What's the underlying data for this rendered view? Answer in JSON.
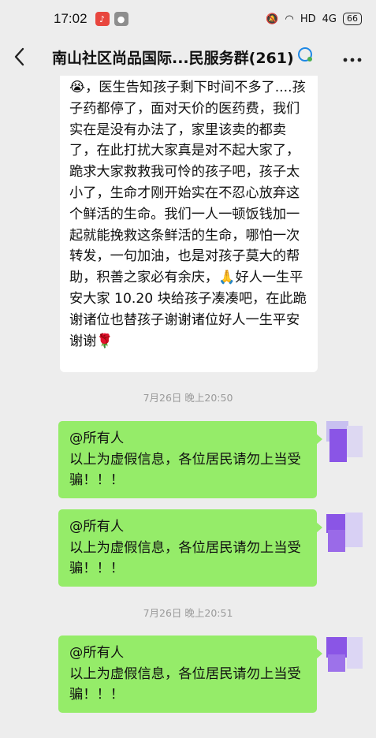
{
  "status_bar": {
    "time": "17:02",
    "network": "HD",
    "signal": "4G",
    "battery": "66"
  },
  "header": {
    "back_icon": "back-chevron-icon",
    "title": "南山社区尚品国际...民服务群(261)",
    "title_icon": "chat-search-icon",
    "more_icon": "more-dots-icon"
  },
  "messages": {
    "long_text": "😭，医生告知孩子剩下时间不多了....孩子药都停了，面对天价的医药费，我们实在是没有办法了，家里该卖的都卖了，在此打扰大家真是对不起大家了，跪求大家救救我可怜的孩子吧，孩子太小了，生命才刚开始实在不忍心放弃这个鲜活的生命。我们一人一顿饭钱加一起就能挽救这条鲜活的生命，哪怕一次转发，一句加油，也是对孩子莫大的帮助，积善之家必有余庆，🙏好人一生平安大家 10.20 块给孩子凑凑吧，在此跪谢诸位也替孩子谢谢诸位好人一生平安谢谢🌹",
    "timestamp_1": "7月26日 晚上20:50",
    "timestamp_2": "7月26日 晚上20:51",
    "bubble_1": {
      "mention": "@所有人",
      "text": "以上为虚假信息，各位居民请勿上当受骗！！！"
    },
    "bubble_2": {
      "mention": "@所有人",
      "text": "以上为虚假信息，各位居民请勿上当受骗！！！"
    },
    "bubble_3": {
      "mention": "@所有人",
      "text": "以上为虚假信息，各位居民请勿上当受骗！！！"
    }
  },
  "colors": {
    "background": "#ededed",
    "self_bubble": "#95ec69",
    "other_bubble": "#ffffff"
  }
}
